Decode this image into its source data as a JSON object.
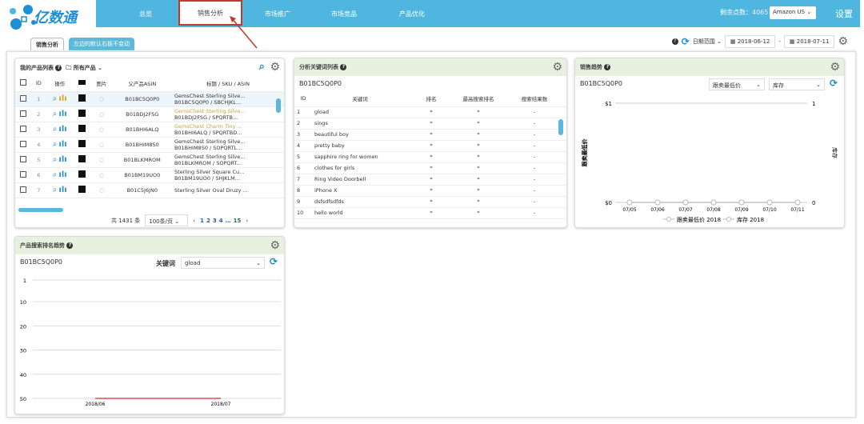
{
  "app": {
    "logo_text": "亿数通",
    "nav": [
      "总览",
      "销售分析",
      "市场推广",
      "市场竞品",
      "产品优化"
    ],
    "active_nav": "销售分析",
    "points_label": "剩余点数：",
    "points": "4065",
    "marketplace": "Amazon US",
    "settings": "设置"
  },
  "tabs": [
    "销售分析",
    "左边的默认右板不变动"
  ],
  "toolbar": {
    "date_range_label": "日期范围",
    "start_date": "2018-06-12",
    "end_date": "2018-07-11",
    "separator": "-"
  },
  "products": {
    "title": "我的产品列表",
    "folder": "所有产品",
    "columns": [
      "ID",
      "操作",
      "",
      "图片",
      "父产品ASIN",
      "标题 / SKU / ASIN"
    ],
    "rows": [
      {
        "id": "1",
        "asin": "B01BC5Q0P0",
        "title": "GemsChest Sterling Silve...",
        "sku": "B01BC5Q0P0 / SBCHJKL...",
        "hl": false
      },
      {
        "id": "2",
        "asin": "B01BDJ2FSG",
        "title": "GemsChest Sterling Silve...",
        "sku": "B01BDJ2FSG / SPQRTB...",
        "hl": true
      },
      {
        "id": "3",
        "asin": "B01BHI6ALQ",
        "title": "GemsChest Charm Tiny ...",
        "sku": "B01BHI6ALQ / SPQRTBD...",
        "hl": true
      },
      {
        "id": "4",
        "asin": "B01BHIM8S0",
        "title": "GemsChest Sterling Silve...",
        "sku": "B01BHIM8S0 / SOPQRTL...",
        "hl": false
      },
      {
        "id": "5",
        "asin": "B01BLKMROM",
        "title": "GemsChest Sterling Silve...",
        "sku": "B01BLKMROM / SOPQRT...",
        "hl": false
      },
      {
        "id": "6",
        "asin": "B01BM19UO0",
        "title": "Sterling Silver Square Cu...",
        "sku": "B01BM19UO0 / SHJKLM...",
        "hl": false
      },
      {
        "id": "7",
        "asin": "B01C5J6JN0",
        "title": "Sterling Silver Oval Druzy ...",
        "sku": "",
        "hl": false
      }
    ],
    "total": "共 1431 条",
    "page_size": "100条/页",
    "pages": [
      "1",
      "2",
      "3",
      "4",
      "…",
      "15"
    ]
  },
  "keywords": {
    "title": "分析关键词列表",
    "asin": "B01BC5Q0P0",
    "columns": [
      "ID",
      "关键词",
      "排名",
      "最高搜索排名",
      "搜索结果数"
    ],
    "rows": [
      [
        "1",
        "gload",
        "*",
        "*",
        "-"
      ],
      [
        "2",
        "sings",
        "*",
        "*",
        "-"
      ],
      [
        "3",
        "beautiful boy",
        "*",
        "*",
        "-"
      ],
      [
        "4",
        "pretty baby",
        "*",
        "*",
        "-"
      ],
      [
        "5",
        "sapphire ring for women",
        "*",
        "*",
        "-"
      ],
      [
        "6",
        "clothes for girls",
        "*",
        "*",
        "-"
      ],
      [
        "7",
        "Ring Video Doorbell",
        "*",
        "*",
        "-"
      ],
      [
        "8",
        "iPhone X",
        "*",
        "*",
        "-"
      ],
      [
        "9",
        "dsfsdfsdfds",
        "*",
        "*",
        "-"
      ],
      [
        "10",
        "hello world",
        "*",
        "*",
        "-"
      ]
    ]
  },
  "sales": {
    "title": "销售趋势",
    "asin": "B01BC5Q0P0",
    "select1": "跟卖最低价",
    "select2": "库存"
  },
  "rank": {
    "title": "产品搜索排名趋势",
    "asin": "B01BC5Q0P0",
    "keyword_label": "关键词",
    "keyword": "gload"
  },
  "chart_data": [
    {
      "type": "line",
      "title": "",
      "x": [
        "07/05",
        "07/06",
        "07/07",
        "07/08",
        "07/09",
        "07/10",
        "07/11"
      ],
      "y_left_ticks": [
        "$0",
        "$1"
      ],
      "y_right_ticks": [
        "0",
        "1"
      ],
      "ylabel": "跟卖最低价",
      "ylabel_right": "库存",
      "series": [
        {
          "name": "跟卖最低价 2018",
          "values": [
            0,
            0,
            0,
            0,
            0,
            0,
            0
          ],
          "color": "#d9b89a"
        },
        {
          "name": "库存 2018",
          "values": [
            0,
            0,
            0,
            0,
            0,
            0,
            0
          ],
          "color": "#cccccc"
        }
      ],
      "legend": "bottom"
    },
    {
      "type": "line",
      "title": "",
      "x": [
        "2018/06",
        "2018/07"
      ],
      "y_ticks": [
        "1",
        "10",
        "20",
        "30",
        "40",
        "50"
      ],
      "ylim": [
        1,
        50
      ],
      "reversed": true,
      "series": [
        {
          "values": [
            50,
            50
          ],
          "color": "#d9534f"
        }
      ]
    }
  ]
}
